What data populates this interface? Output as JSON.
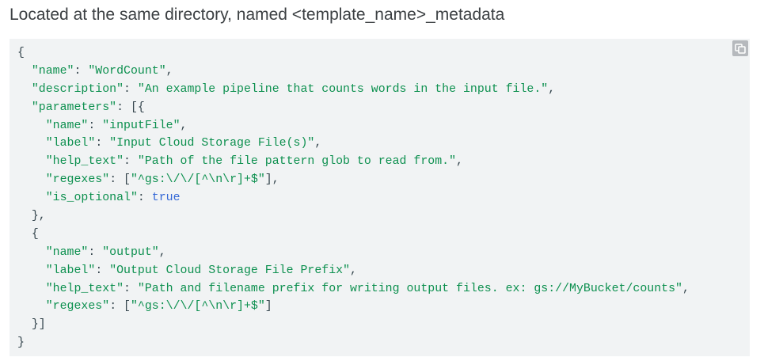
{
  "heading": "Located at the same directory, named <template_name>_metadata",
  "copy_button": {
    "icon": "copy-icon"
  },
  "colors": {
    "string": "#0d904f",
    "boolean": "#3367d6",
    "punctuation": "#37474f",
    "code_background": "#f1f3f4"
  },
  "code_lines": [
    [
      {
        "t": "p",
        "v": "{"
      }
    ],
    [
      {
        "t": "p",
        "v": "  "
      },
      {
        "t": "k",
        "v": "\"name\""
      },
      {
        "t": "p",
        "v": ": "
      },
      {
        "t": "s",
        "v": "\"WordCount\""
      },
      {
        "t": "p",
        "v": ","
      }
    ],
    [
      {
        "t": "p",
        "v": "  "
      },
      {
        "t": "k",
        "v": "\"description\""
      },
      {
        "t": "p",
        "v": ": "
      },
      {
        "t": "s",
        "v": "\"An example pipeline that counts words in the input file.\""
      },
      {
        "t": "p",
        "v": ","
      }
    ],
    [
      {
        "t": "p",
        "v": "  "
      },
      {
        "t": "k",
        "v": "\"parameters\""
      },
      {
        "t": "p",
        "v": ": [{"
      }
    ],
    [
      {
        "t": "p",
        "v": "    "
      },
      {
        "t": "k",
        "v": "\"name\""
      },
      {
        "t": "p",
        "v": ": "
      },
      {
        "t": "s",
        "v": "\"inputFile\""
      },
      {
        "t": "p",
        "v": ","
      }
    ],
    [
      {
        "t": "p",
        "v": "    "
      },
      {
        "t": "k",
        "v": "\"label\""
      },
      {
        "t": "p",
        "v": ": "
      },
      {
        "t": "s",
        "v": "\"Input Cloud Storage File(s)\""
      },
      {
        "t": "p",
        "v": ","
      }
    ],
    [
      {
        "t": "p",
        "v": "    "
      },
      {
        "t": "k",
        "v": "\"help_text\""
      },
      {
        "t": "p",
        "v": ": "
      },
      {
        "t": "s",
        "v": "\"Path of the file pattern glob to read from.\""
      },
      {
        "t": "p",
        "v": ","
      }
    ],
    [
      {
        "t": "p",
        "v": "    "
      },
      {
        "t": "k",
        "v": "\"regexes\""
      },
      {
        "t": "p",
        "v": ": ["
      },
      {
        "t": "s",
        "v": "\"^gs:\\/\\/[^\\n\\r]+$\""
      },
      {
        "t": "p",
        "v": "],"
      }
    ],
    [
      {
        "t": "p",
        "v": "    "
      },
      {
        "t": "k",
        "v": "\"is_optional\""
      },
      {
        "t": "p",
        "v": ": "
      },
      {
        "t": "b",
        "v": "true"
      }
    ],
    [
      {
        "t": "p",
        "v": "  },"
      }
    ],
    [
      {
        "t": "p",
        "v": "  {"
      }
    ],
    [
      {
        "t": "p",
        "v": "    "
      },
      {
        "t": "k",
        "v": "\"name\""
      },
      {
        "t": "p",
        "v": ": "
      },
      {
        "t": "s",
        "v": "\"output\""
      },
      {
        "t": "p",
        "v": ","
      }
    ],
    [
      {
        "t": "p",
        "v": "    "
      },
      {
        "t": "k",
        "v": "\"label\""
      },
      {
        "t": "p",
        "v": ": "
      },
      {
        "t": "s",
        "v": "\"Output Cloud Storage File Prefix\""
      },
      {
        "t": "p",
        "v": ","
      }
    ],
    [
      {
        "t": "p",
        "v": "    "
      },
      {
        "t": "k",
        "v": "\"help_text\""
      },
      {
        "t": "p",
        "v": ": "
      },
      {
        "t": "s",
        "v": "\"Path and filename prefix for writing output files. ex: gs://MyBucket/counts\""
      },
      {
        "t": "p",
        "v": ","
      }
    ],
    [
      {
        "t": "p",
        "v": "    "
      },
      {
        "t": "k",
        "v": "\"regexes\""
      },
      {
        "t": "p",
        "v": ": ["
      },
      {
        "t": "s",
        "v": "\"^gs:\\/\\/[^\\n\\r]+$\""
      },
      {
        "t": "p",
        "v": "]"
      }
    ],
    [
      {
        "t": "p",
        "v": "  }]"
      }
    ],
    [
      {
        "t": "p",
        "v": "}"
      }
    ]
  ]
}
